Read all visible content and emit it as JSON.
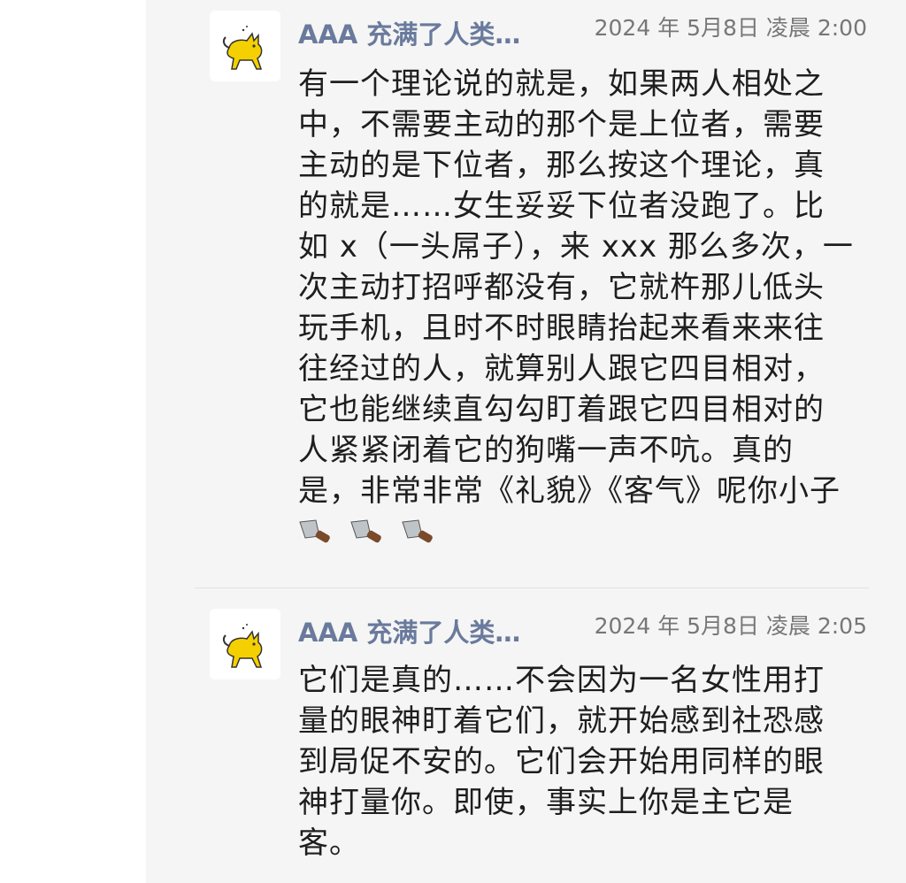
{
  "comments": [
    {
      "author": "AAA 充满了人类…",
      "time": "2024 年 5月8日 凌晨 2:00",
      "avatar_icon": "yellow-cat-icon",
      "lines": [
        "有一个理论说的就是，如果两人相处之",
        "中，不需要主动的那个是上位者，需要",
        "主动的是下位者，那么按这个理论，真",
        "的就是……女生妥妥下位者没跑了。比",
        "如 x（一头屌子），来 xxx 那么多次，一",
        "次主动打招呼都没有，它就杵那儿低头",
        "玩手机，且时不时眼睛抬起来看来来往",
        "往经过的人，就算别人跟它四目相对，",
        "它也能继续直勾勾盯着跟它四目相对的",
        "人紧紧闭着它的狗嘴一声不吭。真的",
        "是，非常非常《礼貌》《客气》呢你小子"
      ],
      "emoji": [
        "knife-emoji",
        "knife-emoji",
        "knife-emoji"
      ]
    },
    {
      "author": "AAA 充满了人类…",
      "time": "2024 年 5月8日 凌晨 2:05",
      "avatar_icon": "yellow-cat-icon",
      "lines": [
        "它们是真的……不会因为一名女性用打",
        "量的眼神盯着它们，就开始感到社恐感",
        "到局促不安的。它们会开始用同样的眼",
        "神打量你。即使，事实上你是主它是",
        "客。"
      ]
    }
  ],
  "colors": {
    "background": "#f5f5f5",
    "author": "#6a7a9c",
    "time": "#777777",
    "text": "#1e1e1e",
    "avatar_cat": "#f5d000"
  }
}
